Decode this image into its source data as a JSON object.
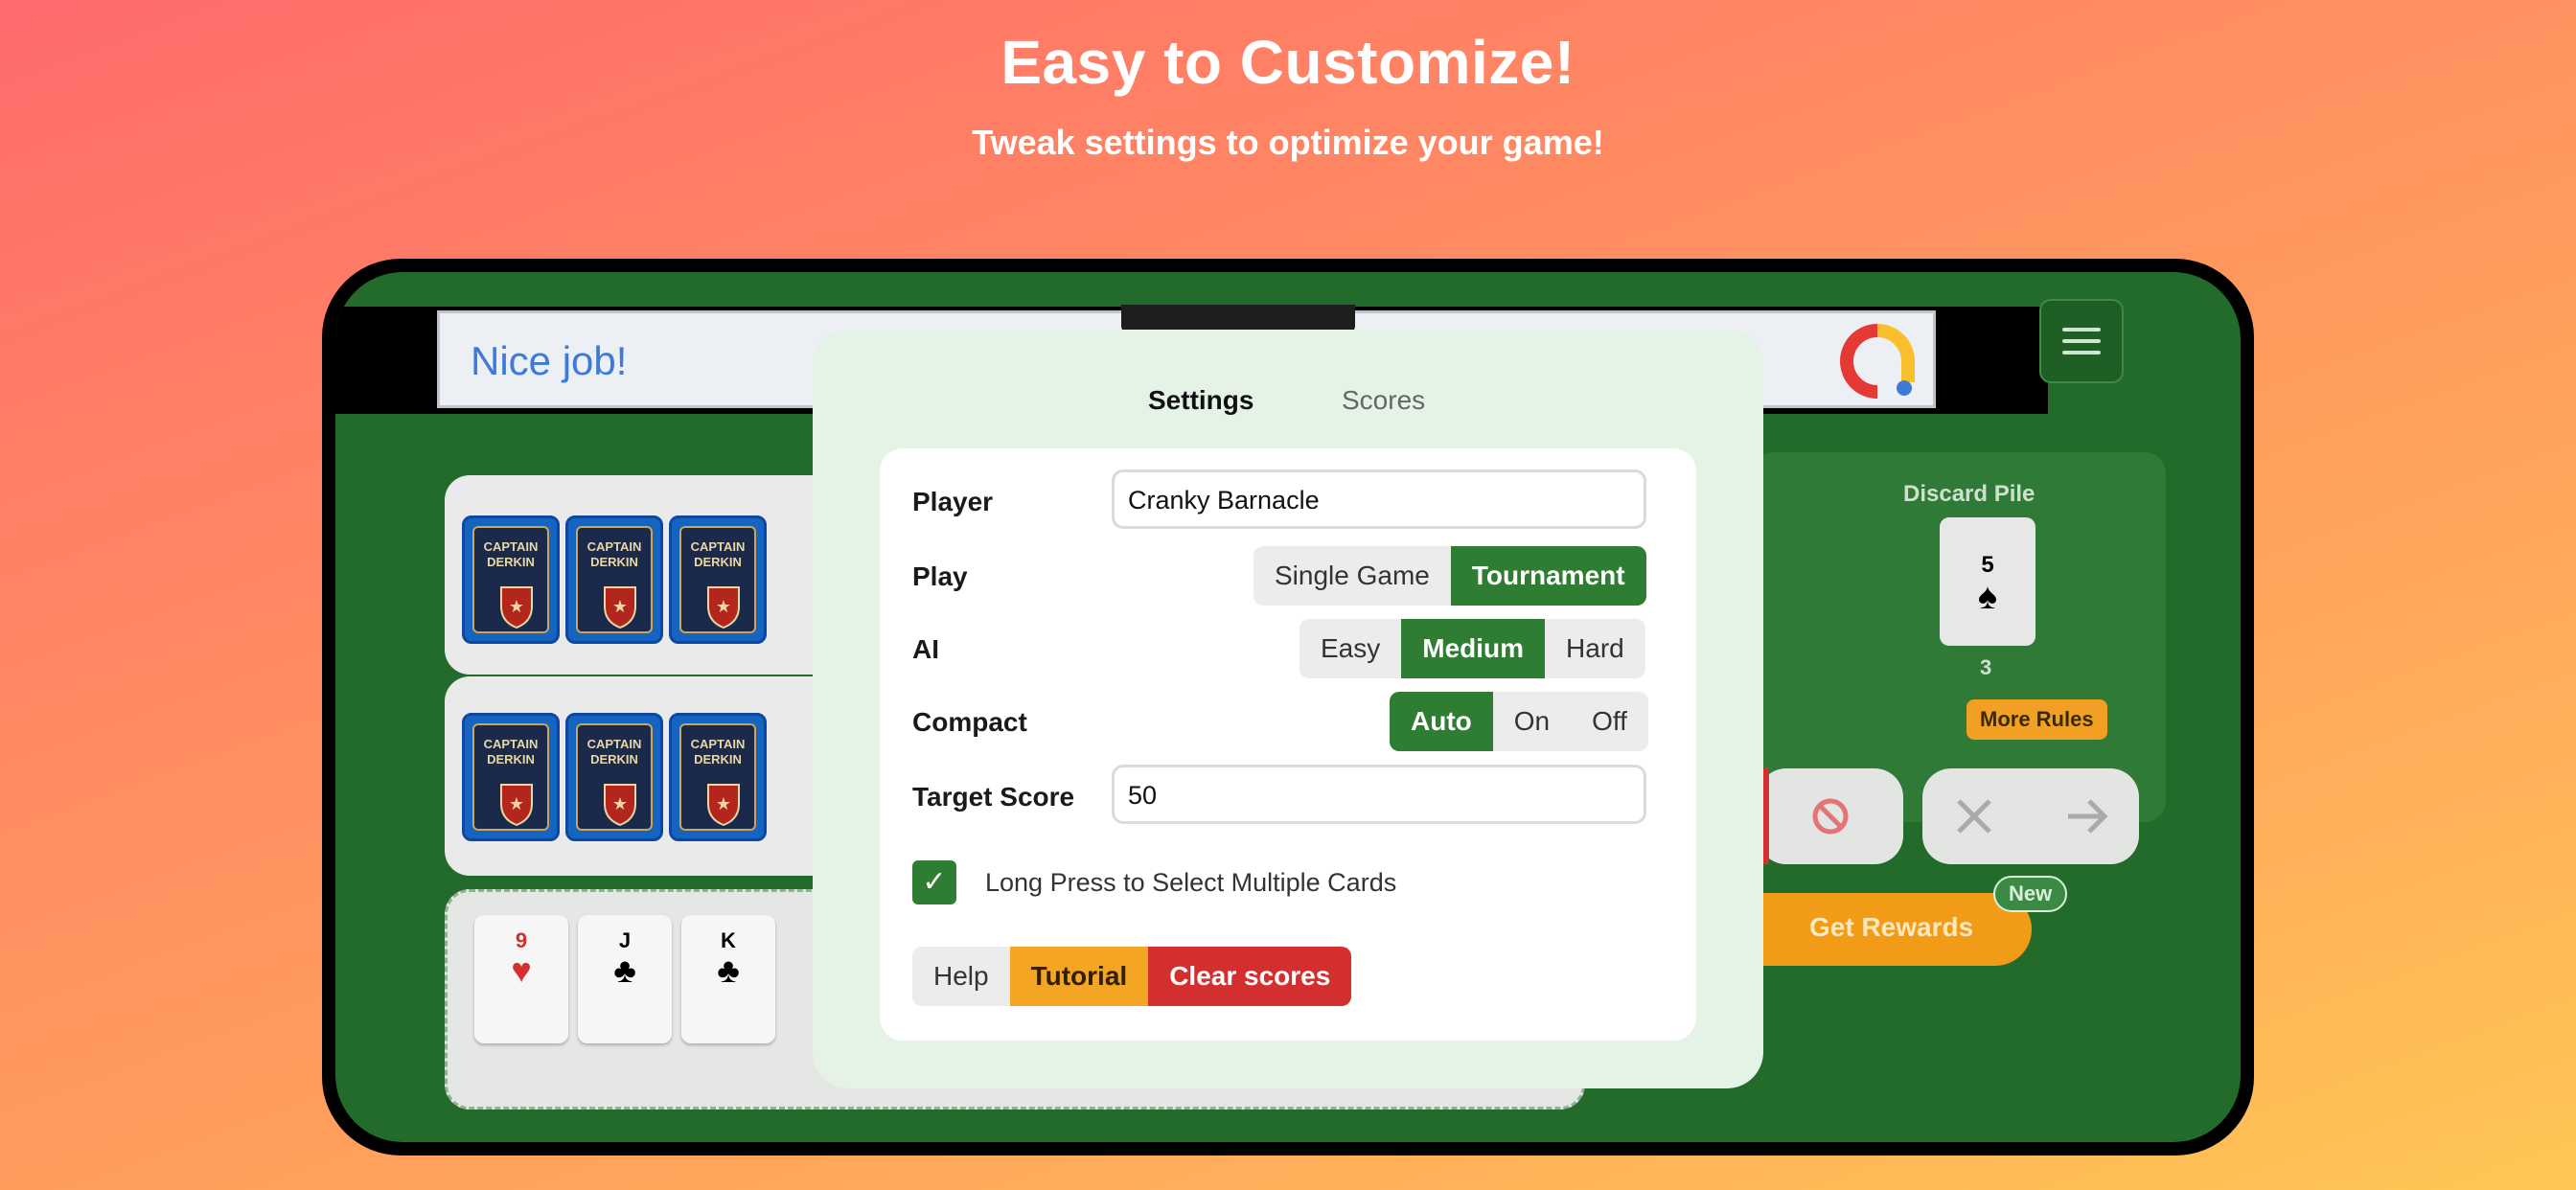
{
  "promo": {
    "title": "Easy to Customize!",
    "subtitle": "Tweak settings to optimize your game!"
  },
  "ad": {
    "text": "Nice job!"
  },
  "game": {
    "card_back_text": [
      "CAPTAIN",
      "DERKIN"
    ],
    "hand_cards": [
      {
        "rank": "9",
        "suit": "♥",
        "color": "#d32f2f"
      },
      {
        "rank": "J",
        "suit": "♣",
        "color": "#1a1a1a"
      },
      {
        "rank": "K",
        "suit": "♣",
        "color": "#1a1a1a"
      }
    ],
    "discard_label": "Discard Pile",
    "discard_card": {
      "rank": "5",
      "suit": "♠"
    },
    "discard_count": "3",
    "more_rules": "More Rules",
    "get_rewards": "Get Rewards",
    "new_badge": "New",
    "block_icon": "block-icon",
    "close_icon": "close-icon",
    "arrow_icon": "arrow-right-icon"
  },
  "settings": {
    "tabs": [
      {
        "label": "Settings",
        "active": true
      },
      {
        "label": "Scores",
        "active": false
      }
    ],
    "player": {
      "label": "Player",
      "value": "Cranky Barnacle"
    },
    "play": {
      "label": "Play",
      "options": [
        "Single Game",
        "Tournament"
      ],
      "selected": "Tournament"
    },
    "ai": {
      "label": "AI",
      "options": [
        "Easy",
        "Medium",
        "Hard"
      ],
      "selected": "Medium"
    },
    "compact": {
      "label": "Compact",
      "options": [
        "Auto",
        "On",
        "Off"
      ],
      "selected": "Auto"
    },
    "target_score": {
      "label": "Target Score",
      "value": "50"
    },
    "long_press": {
      "label": "Long Press to Select Multiple Cards",
      "checked": true
    },
    "buttons": {
      "help": "Help",
      "tutorial": "Tutorial",
      "clear": "Clear scores"
    }
  },
  "colors": {
    "accent_green": "#2e7d32",
    "table_green": "#236b2b",
    "tutorial_orange": "#f5a524",
    "danger_red": "#d32f2f"
  }
}
